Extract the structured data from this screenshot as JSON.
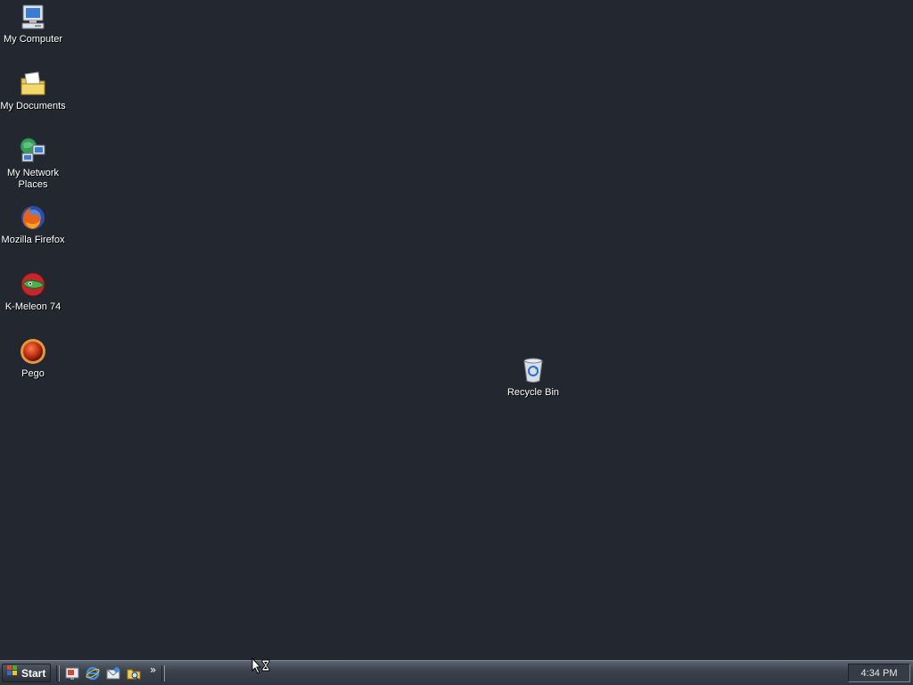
{
  "desktop": {
    "background": "#232830",
    "icons": [
      {
        "label": "My Computer",
        "icon": "my-computer-icon"
      },
      {
        "label": "My Documents",
        "icon": "my-documents-icon"
      },
      {
        "label": "My Network\nPlaces",
        "icon": "my-network-places-icon"
      },
      {
        "label": "Mozilla Firefox",
        "icon": "firefox-icon"
      },
      {
        "label": "K-Meleon 74",
        "icon": "k-meleon-icon"
      },
      {
        "label": "Pego",
        "icon": "pego-icon"
      }
    ],
    "recycle_bin": {
      "label": "Recycle Bin",
      "icon": "recycle-bin-icon"
    }
  },
  "taskbar": {
    "start_label": "Start",
    "quick_launch": [
      {
        "icon": "show-desktop-icon"
      },
      {
        "icon": "internet-explorer-icon"
      },
      {
        "icon": "outlook-express-icon"
      },
      {
        "icon": "windows-explorer-icon"
      }
    ],
    "chevron": "»",
    "clock": "4:34 PM"
  }
}
